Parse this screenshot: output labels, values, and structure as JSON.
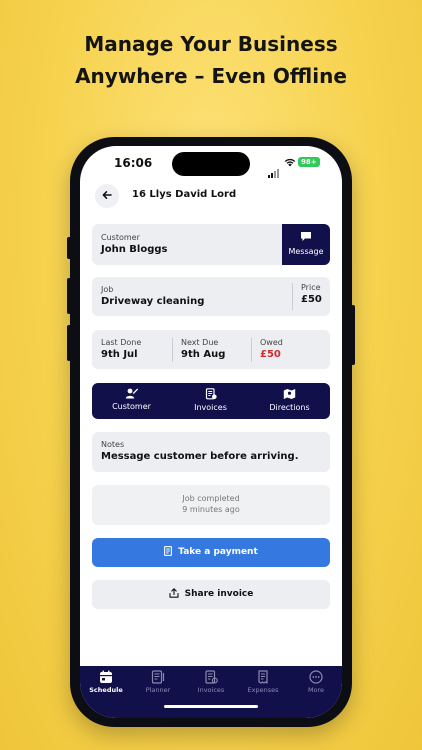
{
  "headline": {
    "line1": "Manage Your Business",
    "line2": "Anywhere – Even Offline"
  },
  "status_bar": {
    "time": "16:06",
    "battery": "98+"
  },
  "header": {
    "title": "16 Llys David Lord",
    "back_icon": "arrow-left-icon"
  },
  "customer": {
    "label": "Customer",
    "name": "John Bloggs",
    "message_label": "Message"
  },
  "job": {
    "label": "Job",
    "value": "Driveway cleaning",
    "price_label": "Price",
    "price": "£50"
  },
  "dates": {
    "last_done_label": "Last Done",
    "last_done": "9th Jul",
    "next_due_label": "Next Due",
    "next_due": "9th Aug",
    "owed_label": "Owed",
    "owed": "£50"
  },
  "actions": [
    {
      "label": "Customer",
      "icon": "customer-icon"
    },
    {
      "label": "Invoices",
      "icon": "invoice-icon"
    },
    {
      "label": "Directions",
      "icon": "map-icon"
    }
  ],
  "notes": {
    "label": "Notes",
    "value": "Message customer before arriving."
  },
  "job_status": {
    "line1": "Job completed",
    "line2": "9 minutes ago"
  },
  "buttons": {
    "take_payment": "Take a payment",
    "share_invoice": "Share invoice"
  },
  "tabbar": [
    {
      "label": "Schedule",
      "icon": "calendar-icon",
      "active": true
    },
    {
      "label": "Planner",
      "icon": "planner-icon",
      "active": false
    },
    {
      "label": "Invoices",
      "icon": "invoice-icon",
      "active": false
    },
    {
      "label": "Expenses",
      "icon": "receipt-icon",
      "active": false
    },
    {
      "label": "More",
      "icon": "more-icon",
      "active": false
    }
  ],
  "colors": {
    "background": "#f6d24e",
    "navy": "#12104a",
    "primary_blue": "#3478e0",
    "owed_red": "#d42a2a",
    "battery_green": "#34c759"
  }
}
